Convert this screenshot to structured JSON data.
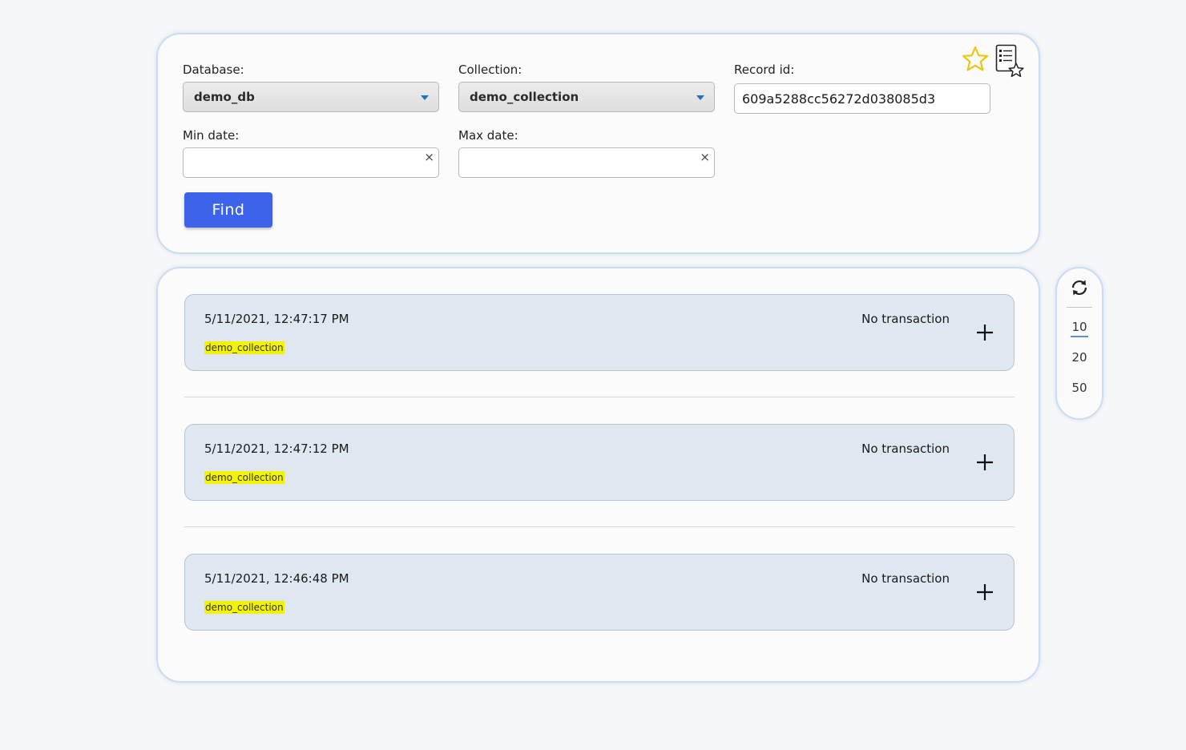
{
  "search": {
    "database_label": "Database:",
    "database_value": "demo_db",
    "collection_label": "Collection:",
    "collection_value": "demo_collection",
    "record_id_label": "Record id:",
    "record_id_value": "609a5288cc56272d038085d3",
    "min_date_label": "Min date:",
    "min_date_value": "",
    "max_date_label": "Max date:",
    "max_date_value": "",
    "clear_symbol": "×",
    "find_label": "Find",
    "icons": [
      "star-icon",
      "favorites-list-icon"
    ]
  },
  "records": [
    {
      "timestamp": "5/11/2021, 12:47:17 PM",
      "collection": "demo_collection",
      "transaction": "No transaction"
    },
    {
      "timestamp": "5/11/2021, 12:47:12 PM",
      "collection": "demo_collection",
      "transaction": "No transaction"
    },
    {
      "timestamp": "5/11/2021, 12:46:48 PM",
      "collection": "demo_collection",
      "transaction": "No transaction"
    }
  ],
  "sidebar": {
    "refresh_icon": "refresh-icon",
    "page_sizes": [
      "10",
      "20",
      "50"
    ],
    "selected_page_size": "10"
  },
  "colors": {
    "accent": "#3c63e8",
    "highlight": "#f3f300",
    "card": "#dfe8f1",
    "panel_border": "#c9dcf2"
  }
}
